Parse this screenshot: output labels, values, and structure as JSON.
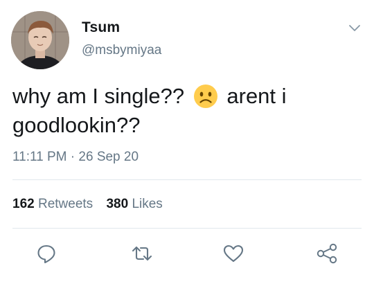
{
  "user": {
    "display_name": "Tsum",
    "handle": "@msbymiyaa",
    "avatar_icon": "avatar-portrait"
  },
  "tweet": {
    "text_part1": "why am I single??",
    "emoji_icon": "frowning-face-emoji",
    "text_part2": "arent i goodlookin??",
    "time": "11:11 PM",
    "separator": "·",
    "date": "26 Sep 20"
  },
  "stats": {
    "retweets_count": "162",
    "retweets_label": "Retweets",
    "likes_count": "380",
    "likes_label": "Likes"
  },
  "actions": [
    {
      "icon": "reply-icon"
    },
    {
      "icon": "retweet-icon"
    },
    {
      "icon": "like-icon"
    },
    {
      "icon": "share-icon"
    }
  ],
  "colors": {
    "primary_text": "#14171a",
    "secondary_text": "#657786",
    "divider": "#e1e8ed",
    "emoji_face": "#FFCC4D"
  }
}
